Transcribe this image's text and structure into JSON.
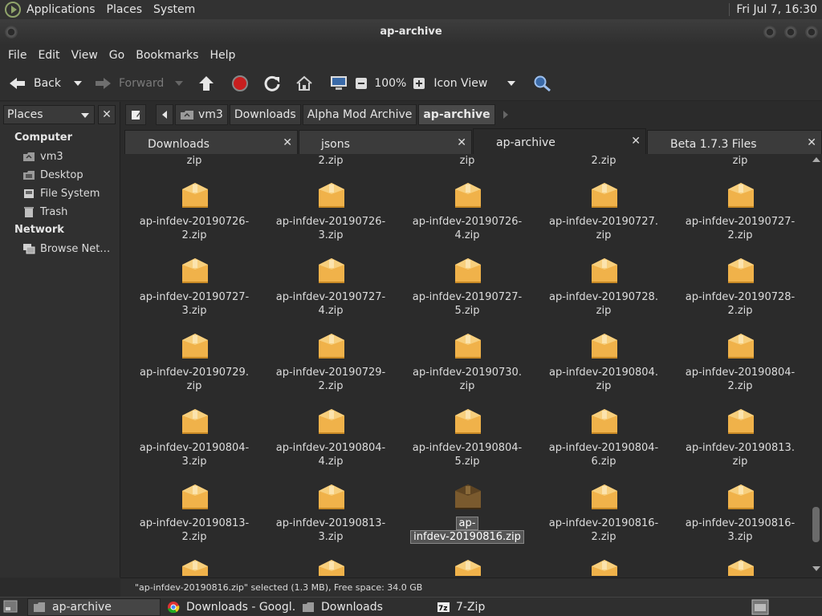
{
  "top_panel": {
    "menus": [
      "Applications",
      "Places",
      "System"
    ],
    "clock": "Fri Jul  7, 16:30"
  },
  "window": {
    "title": "ap-archive"
  },
  "menubar": [
    "File",
    "Edit",
    "View",
    "Go",
    "Bookmarks",
    "Help"
  ],
  "toolbar": {
    "back": "Back",
    "forward": "Forward",
    "zoom": "100%",
    "view_mode": "Icon View"
  },
  "sidebar": {
    "header": "Places",
    "close": "✕",
    "sections": [
      {
        "title": "Computer",
        "items": [
          "vm3",
          "Desktop",
          "File System",
          "Trash"
        ]
      },
      {
        "title": "Network",
        "items": [
          "Browse Net…"
        ]
      }
    ]
  },
  "pathbar": {
    "crumbs": [
      "vm3",
      "Downloads",
      "Alpha Mod Archive",
      "ap-archive"
    ]
  },
  "tabs": [
    {
      "label": "Downloads",
      "close": "✕"
    },
    {
      "label": "jsons",
      "close": "✕"
    },
    {
      "label": "ap-archive",
      "close": "✕"
    },
    {
      "label": "Beta 1.7.3 Files",
      "close": "✕"
    }
  ],
  "top_partial_labels": [
    "zip",
    "2.zip",
    "zip",
    "2.zip",
    "zip"
  ],
  "files": [
    [
      "ap-infdev-20190726-",
      "2.zip"
    ],
    [
      "ap-infdev-20190726-",
      "3.zip"
    ],
    [
      "ap-infdev-20190726-",
      "4.zip"
    ],
    [
      "ap-infdev-20190727.",
      "zip"
    ],
    [
      "ap-infdev-20190727-",
      "2.zip"
    ],
    [
      "ap-infdev-20190727-",
      "3.zip"
    ],
    [
      "ap-infdev-20190727-",
      "4.zip"
    ],
    [
      "ap-infdev-20190727-",
      "5.zip"
    ],
    [
      "ap-infdev-20190728.",
      "zip"
    ],
    [
      "ap-infdev-20190728-",
      "2.zip"
    ],
    [
      "ap-infdev-20190729.",
      "zip"
    ],
    [
      "ap-infdev-20190729-",
      "2.zip"
    ],
    [
      "ap-infdev-20190730.",
      "zip"
    ],
    [
      "ap-infdev-20190804.",
      "zip"
    ],
    [
      "ap-infdev-20190804-",
      "2.zip"
    ],
    [
      "ap-infdev-20190804-",
      "3.zip"
    ],
    [
      "ap-infdev-20190804-",
      "4.zip"
    ],
    [
      "ap-infdev-20190804-",
      "5.zip"
    ],
    [
      "ap-infdev-20190804-",
      "6.zip"
    ],
    [
      "ap-infdev-20190813.",
      "zip"
    ],
    [
      "ap-infdev-20190813-",
      "2.zip"
    ],
    [
      "ap-infdev-20190813-",
      "3.zip"
    ],
    [
      "ap-",
      "infdev-20190816.zip"
    ],
    [
      "ap-infdev-20190816-",
      "2.zip"
    ],
    [
      "ap-infdev-20190816-",
      "3.zip"
    ]
  ],
  "selected_index": 22,
  "status": "\"ap-infdev-20190816.zip\" selected (1.3 MB), Free space: 34.0 GB",
  "taskbar": [
    "ap-archive",
    "Downloads - Googl…",
    "Downloads",
    "7-Zip"
  ],
  "colors": {
    "accent": "#8fa36a",
    "package": "#f0b24a",
    "selected_package": "#7a5a2e"
  }
}
